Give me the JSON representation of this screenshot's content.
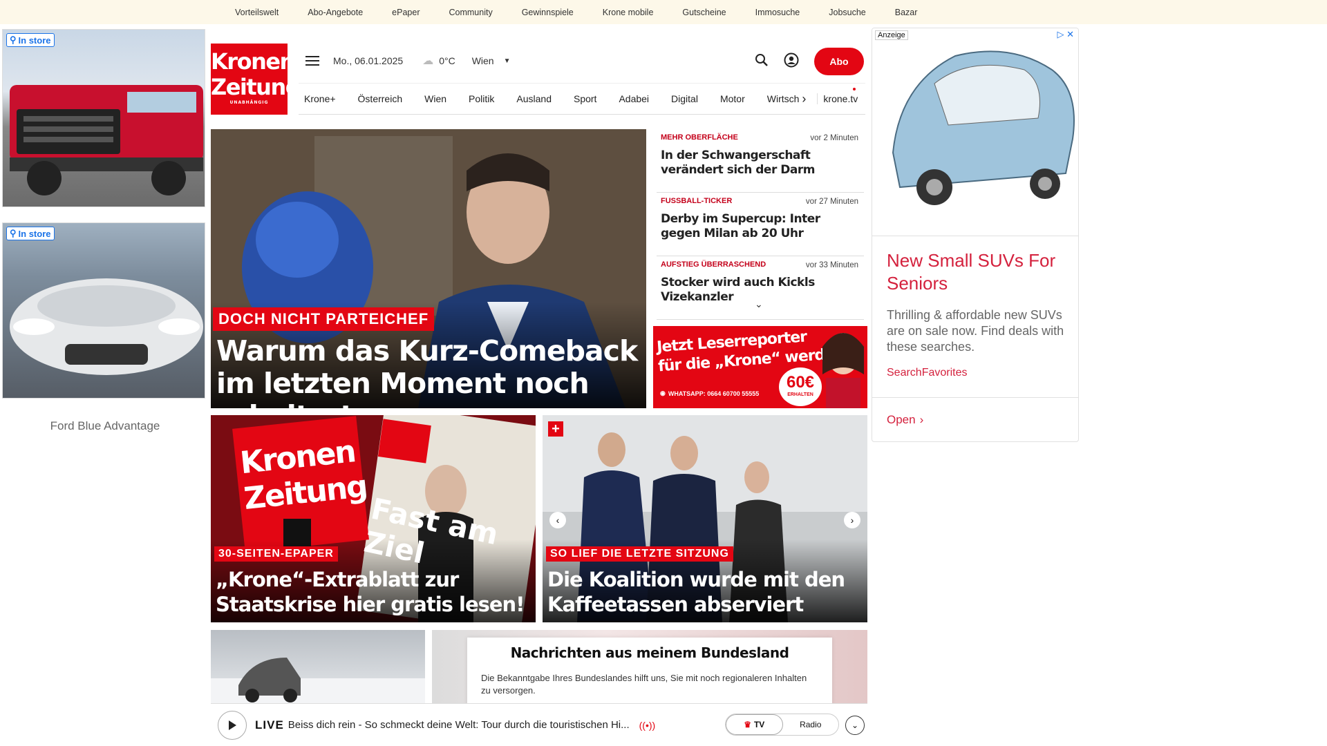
{
  "topbar": {
    "links": [
      "Vorteilswelt",
      "Abo-Angebote",
      "ePaper",
      "Community",
      "Gewinnspiele",
      "Krone mobile",
      "Gutscheine",
      "Immosuche",
      "Jobsuche",
      "Bazar"
    ]
  },
  "left_ad": {
    "badge1": "In store",
    "badge2": "In store",
    "brand": "Ford Blue Advantage"
  },
  "logo": {
    "line1": "Kronen",
    "line2": "Zeitung",
    "tag": "UNABHÄNGIG"
  },
  "header": {
    "date": "Mo., 06.01.2025",
    "temp": "0°C",
    "city": "Wien",
    "abo": "Abo"
  },
  "nav": {
    "items": [
      "Krone+",
      "Österreich",
      "Wien",
      "Politik",
      "Ausland",
      "Sport",
      "Adabei",
      "Digital",
      "Motor",
      "Wirtsch"
    ],
    "tv": "krone.tv"
  },
  "hero": {
    "kicker": "DOCH NICHT PARTEICHEF",
    "title": "Warum das Kurz-Comeback im letzten Moment noch scheiterte"
  },
  "news": [
    {
      "kicker": "MEHR OBERFLÄCHE",
      "time": "vor 2 Minuten",
      "title": "In der Schwangerschaft verändert sich der Darm"
    },
    {
      "kicker": "FUSSBALL-TICKER",
      "time": "vor 27 Minuten",
      "title": "Derby im Supercup: Inter gegen Milan ab 20 Uhr"
    },
    {
      "kicker": "AUFSTIEG ÜBERRASCHEND",
      "time": "vor 33 Minuten",
      "title": "Stocker wird auch Kickls Vizekanzler"
    }
  ],
  "promo": {
    "line1": "Jetzt Leserreporter",
    "line2": "für die „Krone“ werden",
    "whatsapp": "WHATSAPP: 0664 60700 55555",
    "amount": "60€",
    "amount_sub": "ERHALTEN"
  },
  "right_ad": {
    "label": "Anzeige",
    "title": "New Small SUVs For Seniors",
    "text": "Thrilling & affordable new SUVs are on sale now. Find deals with these searches.",
    "source": "SearchFavorites",
    "open": "Open"
  },
  "card1": {
    "kicker": "30-SEITEN-EPAPER",
    "title": "„Krone“-Extrablatt zur Staatskrise hier gratis lesen!",
    "paper_logo1": "Kronen",
    "paper_logo2": "Zeitung",
    "paper_headline": "Fast am Ziel"
  },
  "card2": {
    "kicker": "SO LIEF DIE LETZTE SITZUNG",
    "title": "Die Koalition wurde mit den Kaffeetassen abserviert",
    "plus": "+"
  },
  "bundesland": {
    "title": "Nachrichten aus meinem Bundesland",
    "text": "Die Bekanntgabe Ihres Bundeslandes hilft uns, Sie mit noch regionaleren Inhalten zu versorgen."
  },
  "player": {
    "live": "LIVE",
    "title": "Beiss dich rein - So schmeckt deine Welt: Tour durch die touristischen Hi...",
    "tv": "TV",
    "radio": "Radio"
  }
}
